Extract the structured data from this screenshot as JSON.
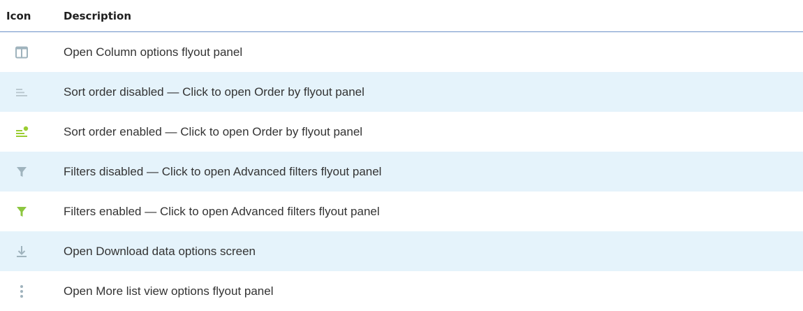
{
  "table": {
    "headers": {
      "icon": "Icon",
      "description": "Description"
    },
    "rows": [
      {
        "icon": "columns-icon",
        "icon_color": "#9fb3bd",
        "description": "Open Column options flyout panel"
      },
      {
        "icon": "sort-disabled-icon",
        "icon_color": "#b7c5cc",
        "description": "Sort order disabled — Click to open Order by flyout panel"
      },
      {
        "icon": "sort-enabled-icon",
        "icon_color": "#9acd32",
        "description": "Sort order enabled — Click to open Order by flyout panel"
      },
      {
        "icon": "filter-disabled-icon",
        "icon_color": "#9fb3bd",
        "description": "Filters disabled — Click to open Advanced filters flyout panel"
      },
      {
        "icon": "filter-enabled-icon",
        "icon_color": "#8cc63f",
        "description": "Filters enabled — Click to open Advanced filters flyout panel"
      },
      {
        "icon": "download-icon",
        "icon_color": "#9fb3bd",
        "description": "Open Download data options screen"
      },
      {
        "icon": "more-options-icon",
        "icon_color": "#9fb3bd",
        "description": "Open More list view options flyout panel"
      }
    ],
    "colors": {
      "header_rule": "#6b8fc8",
      "shaded_row": "#e5f3fb",
      "enabled_green": "#8cc63f",
      "disabled_gray": "#9fb3bd"
    }
  }
}
